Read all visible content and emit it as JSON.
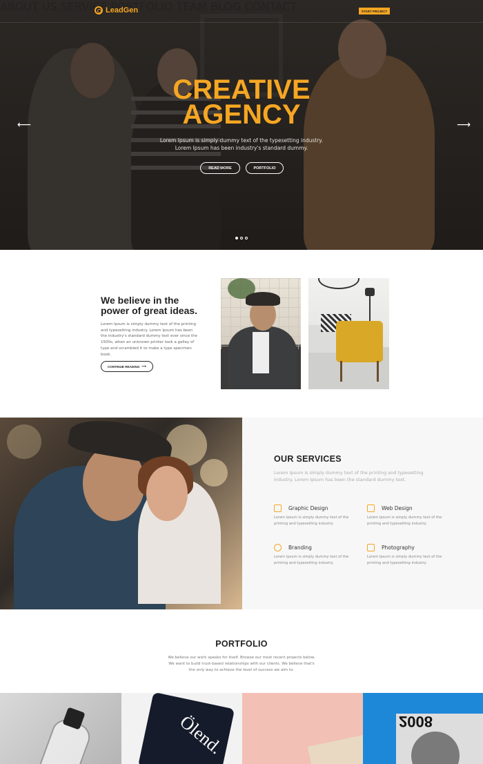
{
  "brand": {
    "name": "LeadGen",
    "accent": "#f5a623"
  },
  "nav": {
    "items": [
      "ABOUT US",
      "SERVICE",
      "PORTFOLIO",
      "TEAM",
      "BLOG",
      "CONTACT"
    ],
    "cta": "START PROJECT"
  },
  "hero": {
    "title_line1": "CREATIVE",
    "title_line2": "AGENCY",
    "subtitle_line1": "Lorem Ipsum is simply dummy text of the typesetting industry.",
    "subtitle_line2": "Lorem Ipsum has been industry's standard dummy.",
    "btn_read_more": "READ MORE",
    "btn_portfolio": "PORTFOLIO",
    "prev_arrow": "⟵",
    "next_arrow": "⟶",
    "slides_total": 3,
    "active_slide": 1
  },
  "about": {
    "title_line1": "We believe in the",
    "title_line2": "power of great ideas.",
    "text": "Lorem Ipsum is simply dummy text of the printing and typesetting industry. Lorem Ipsum has been the industry's standard dummy text ever since the 1500s, when an unknown printer took a galley of type and scrambled it to make a type specimen book.",
    "button": "CONTINUE READING",
    "button_arrow": "⟶"
  },
  "services": {
    "title": "OUR SERVICES",
    "subtitle": "Lorem Ipsum is simply dummy text of the printing and typesetting industry. Lorem Ipsum has been the standard dummy text.",
    "items": [
      {
        "name": "Graphic Design",
        "icon": "monitor-icon",
        "desc": "Lorem Ipsum is simply dummy text of the printing and typesetting industry."
      },
      {
        "name": "Web Design",
        "icon": "pencil-ruler-icon",
        "desc": "Lorem Ipsum is simply dummy text of the printing and typesetting industry."
      },
      {
        "name": "Branding",
        "icon": "globe-icon",
        "desc": "Lorem Ipsum is simply dummy text of the printing and typesetting industry."
      },
      {
        "name": "Photography",
        "icon": "camera-icon",
        "desc": "Lorem Ipsum is simply dummy text of the printing and typesetting industry."
      }
    ]
  },
  "portfolio": {
    "title": "PORTFOLIO",
    "subtitle": "We believe our work speaks for itself. Browse our most recent projects below. We want to build trust-based relationships with our clients. We believe that's the only way to achieve the level of success we aim to.",
    "tile_texts": {
      "t2": "Ölend.",
      "t4": "2008"
    }
  }
}
